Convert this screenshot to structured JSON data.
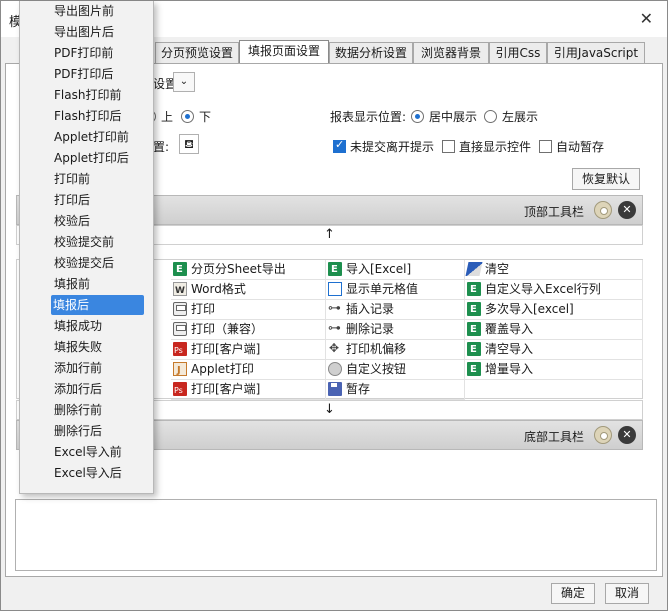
{
  "window": {
    "title": "模"
  },
  "tabs": [
    {
      "label": "分页预览设置"
    },
    {
      "label": "填报页面设置"
    },
    {
      "label": "数据分析设置"
    },
    {
      "label": "浏览器背景"
    },
    {
      "label": "引用Css"
    },
    {
      "label": "引用JavaScript"
    }
  ],
  "settings": {
    "combo_label": "设置",
    "pos_up": "上",
    "pos_down": "下",
    "display_label": "报表显示位置:",
    "center": "居中展示",
    "left": "左展示",
    "position_label": "置:",
    "uncommitted": "未提交离开提示",
    "show_control": "直接显示控件",
    "autosave": "自动暂存",
    "restore": "恢复默认"
  },
  "toolbar": {
    "top_label": "顶部工具栏",
    "bottom_label": "底部工具栏",
    "up_arrow": "↑",
    "down_arrow": "↓"
  },
  "buttons": {
    "col1": [
      "分页分Sheet导出",
      "Word格式",
      "打印",
      "打印（兼容）",
      "打印[客户端]",
      "Applet打印",
      "打印[客户端]"
    ],
    "col2": [
      "导入[Excel]",
      "显示单元格值",
      "插入记录",
      "删除记录",
      "打印机偏移",
      "自定义按钮",
      "暂存"
    ],
    "col3": [
      "清空",
      "自定义导入Excel行列",
      "多次导入[excel]",
      "覆盖导入",
      "清空导入",
      "增量导入"
    ]
  },
  "dropdown": {
    "items": [
      "导出图片前",
      "导出图片后",
      "PDF打印前",
      "PDF打印后",
      "Flash打印前",
      "Flash打印后",
      "Applet打印前",
      "Applet打印后",
      "打印前",
      "打印后",
      "校验后",
      "校验提交前",
      "校验提交后",
      "填报前",
      "填报后",
      "填报成功",
      "填报失败",
      "添加行前",
      "添加行后",
      "删除行前",
      "删除行后",
      "Excel导入前",
      "Excel导入后"
    ],
    "selected": "填报后"
  },
  "footer": {
    "ok": "确定",
    "cancel": "取消"
  }
}
